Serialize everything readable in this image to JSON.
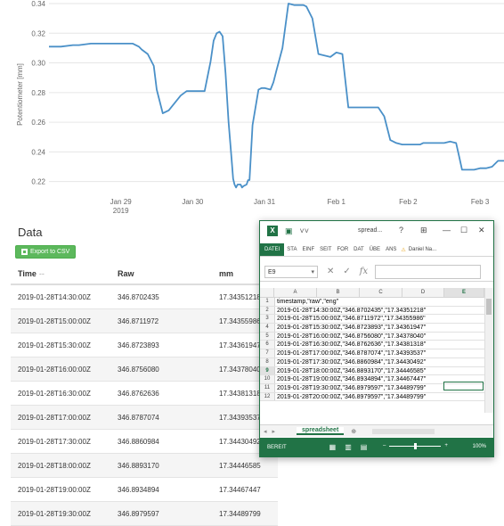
{
  "chart_data": {
    "type": "line",
    "ylabel": "Potentiometer [mm]",
    "ylim": [
      0.215,
      0.34
    ],
    "yticks": [
      0.22,
      0.24,
      0.26,
      0.28,
      0.3,
      0.32,
      0.34
    ],
    "ytick_labels": [
      "0.22",
      "0.24",
      "0.26",
      "0.28",
      "0.30",
      "0.32",
      "0.34"
    ],
    "xlim": [
      0,
      152
    ],
    "xticks": [
      24,
      48,
      72,
      96,
      120,
      144
    ],
    "xtick_labels": [
      "Jan 29",
      "Jan 30",
      "Jan 31",
      "Feb 1",
      "Feb 2",
      "Feb 3"
    ],
    "xtick_sublabels": [
      "2019",
      "",
      "",
      "",
      "",
      ""
    ],
    "grid": "horizontal",
    "color": "#4a90c8",
    "series": [
      {
        "x": [
          0,
          4,
          8,
          10,
          14,
          18,
          20,
          25,
          28,
          30,
          31,
          33,
          35,
          36,
          38,
          40,
          44,
          46,
          47,
          48,
          48.5,
          49,
          52,
          54,
          55,
          56,
          57,
          58,
          59,
          60,
          61,
          61.5,
          62,
          62.5,
          63,
          64,
          64.5,
          65,
          66,
          66.5,
          67,
          68,
          70,
          71,
          72,
          74,
          75,
          76,
          78,
          80,
          82,
          84,
          85,
          86,
          88,
          90,
          92,
          94,
          96,
          98,
          100,
          104,
          106,
          108,
          110,
          112,
          114,
          116,
          118,
          120,
          124,
          125,
          126,
          128,
          130,
          132,
          134,
          136,
          137,
          138,
          140,
          141,
          142,
          144,
          146,
          148,
          150,
          152
        ],
        "y": [
          0.311,
          0.311,
          0.312,
          0.312,
          0.313,
          0.313,
          0.313,
          0.313,
          0.313,
          0.311,
          0.309,
          0.306,
          0.298,
          0.282,
          0.266,
          0.268,
          0.278,
          0.281,
          0.281,
          0.281,
          0.281,
          0.281,
          0.281,
          0.301,
          0.315,
          0.32,
          0.321,
          0.318,
          0.293,
          0.26,
          0.235,
          0.222,
          0.218,
          0.216,
          0.218,
          0.218,
          0.216,
          0.217,
          0.218,
          0.221,
          0.221,
          0.258,
          0.282,
          0.283,
          0.283,
          0.282,
          0.287,
          0.295,
          0.31,
          0.34,
          0.339,
          0.339,
          0.339,
          0.338,
          0.33,
          0.306,
          0.305,
          0.304,
          0.307,
          0.306,
          0.27,
          0.27,
          0.27,
          0.27,
          0.27,
          0.264,
          0.248,
          0.246,
          0.245,
          0.245,
          0.245,
          0.246,
          0.246,
          0.246,
          0.246,
          0.246,
          0.247,
          0.246,
          0.237,
          0.228,
          0.228,
          0.228,
          0.228,
          0.229,
          0.229,
          0.23,
          0.234,
          0.234
        ]
      }
    ]
  },
  "data_section": {
    "title": "Data",
    "export_label": "Export to CSV",
    "columns": [
      "Time",
      "Raw",
      "mm"
    ],
    "sort_indicator": "--",
    "rows": [
      [
        "2019-01-28T14:30:00Z",
        "346.8702435",
        "17.34351218"
      ],
      [
        "2019-01-28T15:00:00Z",
        "346.8711972",
        "17.34355986"
      ],
      [
        "2019-01-28T15:30:00Z",
        "346.8723893",
        "17.34361947"
      ],
      [
        "2019-01-28T16:00:00Z",
        "346.8756080",
        "17.34378040"
      ],
      [
        "2019-01-28T16:30:00Z",
        "346.8762636",
        "17.34381318"
      ],
      [
        "2019-01-28T17:00:00Z",
        "346.8787074",
        "17.34393537"
      ],
      [
        "2019-01-28T17:30:00Z",
        "346.8860984",
        "17.34430492"
      ],
      [
        "2019-01-28T18:00:00Z",
        "346.8893170",
        "17.34446585"
      ],
      [
        "2019-01-28T19:00:00Z",
        "346.8934894",
        "17.34467447"
      ],
      [
        "2019-01-28T19:30:00Z",
        "346.8979597",
        "17.34489799"
      ]
    ]
  },
  "excel": {
    "filename": "spread...",
    "question": "?",
    "tabs": [
      "DATEI",
      "STA",
      "EINF",
      "SEIT",
      "FOR",
      "DAT",
      "ÜBE",
      "ANS"
    ],
    "user": "Daniel Na...",
    "namebox": "E9",
    "fx": "fx",
    "col_headers": [
      "A",
      "B",
      "C",
      "D",
      "E"
    ],
    "rows": [
      {
        "n": "1",
        "text": "timestamp,\"raw\",\"eng\""
      },
      {
        "n": "2",
        "text": "2019-01-28T14:30:00Z,\"346.8702435\",\"17.34351218\""
      },
      {
        "n": "3",
        "text": "2019-01-28T15:00:00Z,\"346.8711972\",\"17.34355986\""
      },
      {
        "n": "4",
        "text": "2019-01-28T15:30:00Z,\"346.8723893\",\"17.34361947\""
      },
      {
        "n": "5",
        "text": "2019-01-28T16:00:00Z,\"346.8756080\",\"17.34378040\""
      },
      {
        "n": "6",
        "text": "2019-01-28T16:30:00Z,\"346.8762636\",\"17.34381318\""
      },
      {
        "n": "7",
        "text": "2019-01-28T17:00:00Z,\"346.8787074\",\"17.34393537\""
      },
      {
        "n": "8",
        "text": "2019-01-28T17:30:00Z,\"346.8860984\",\"17.34430492\""
      },
      {
        "n": "9",
        "text": "2019-01-28T18:00:00Z,\"346.8893170\",\"17.34446585\""
      },
      {
        "n": "10",
        "text": "2019-01-28T19:00:00Z,\"346.8934894\",\"17.34467447\""
      },
      {
        "n": "11",
        "text": "2019-01-28T19:30:00Z,\"346.8979597\",\"17.34489799\""
      },
      {
        "n": "12",
        "text": "2019-01-28T20:00:00Z,\"346.8979597\",\"17.34489799\""
      }
    ],
    "selected_row": "9",
    "sheet_name": "spreadsheet",
    "status": "BEREIT",
    "zoom": "100%",
    "accent": "#217346"
  }
}
